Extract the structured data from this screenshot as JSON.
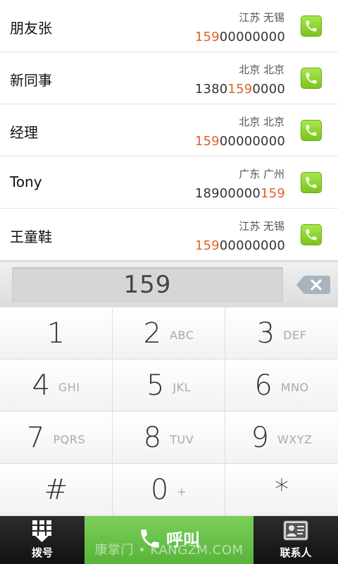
{
  "contacts": [
    {
      "name": "朋友张",
      "location": "江苏 无锡",
      "num_pre": "",
      "num_hl": "159",
      "num_post": "00000000"
    },
    {
      "name": "新同事",
      "location": "北京 北京",
      "num_pre": "1380",
      "num_hl": "159",
      "num_post": "0000"
    },
    {
      "name": "经理",
      "location": "北京 北京",
      "num_pre": "",
      "num_hl": "159",
      "num_post": "00000000"
    },
    {
      "name": "Tony",
      "location": "广东 广州",
      "num_pre": "18900000",
      "num_hl": "159",
      "num_post": ""
    },
    {
      "name": "王童鞋",
      "location": "江苏 无锡",
      "num_pre": "",
      "num_hl": "159",
      "num_post": "00000000"
    }
  ],
  "dial_input": {
    "value": "159"
  },
  "keypad": [
    {
      "digit": "1",
      "letters": ""
    },
    {
      "digit": "2",
      "letters": "ABC"
    },
    {
      "digit": "3",
      "letters": "DEF"
    },
    {
      "digit": "4",
      "letters": "GHI"
    },
    {
      "digit": "5",
      "letters": "JKL"
    },
    {
      "digit": "6",
      "letters": "MNO"
    },
    {
      "digit": "7",
      "letters": "PQRS"
    },
    {
      "digit": "8",
      "letters": "TUV"
    },
    {
      "digit": "9",
      "letters": "WXYZ"
    },
    {
      "digit": "#",
      "letters": ""
    },
    {
      "digit": "0",
      "letters": "+"
    },
    {
      "digit": "*",
      "letters": ""
    }
  ],
  "bottom": {
    "dial_label": "拨号",
    "call_label": "呼叫",
    "contacts_label": "联系人"
  },
  "watermark": "康掌门 • KANGZM.COM",
  "colors": {
    "highlight": "#e0622a",
    "call_green": "#6cc24a",
    "call_icon_green": "#8fd83a"
  }
}
